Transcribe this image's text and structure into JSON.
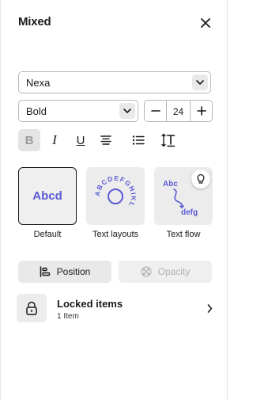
{
  "panel": {
    "title": "Mixed",
    "close_icon": "close-icon"
  },
  "font": {
    "family": "Nexa",
    "weight": "Bold",
    "size": "24"
  },
  "formatting": {
    "bold_label": "B",
    "italic_label": "I",
    "underline_label": "U",
    "bold_active": true
  },
  "text_styles": [
    {
      "label": "Default",
      "preview": "Abcd",
      "selected": true
    },
    {
      "label": "Text layouts",
      "preview": "ABCDEFGHIKL"
    },
    {
      "label": "Text flow",
      "preview_top": "Abc",
      "preview_bottom": "defg"
    }
  ],
  "actions": {
    "position_label": "Position",
    "opacity_label": "Opacity"
  },
  "locked": {
    "title": "Locked items",
    "count": "1 Item"
  },
  "colors": {
    "accent": "#5b5bd6",
    "border": "#b8b8b8",
    "disabled_text": "#b3b3b3"
  }
}
